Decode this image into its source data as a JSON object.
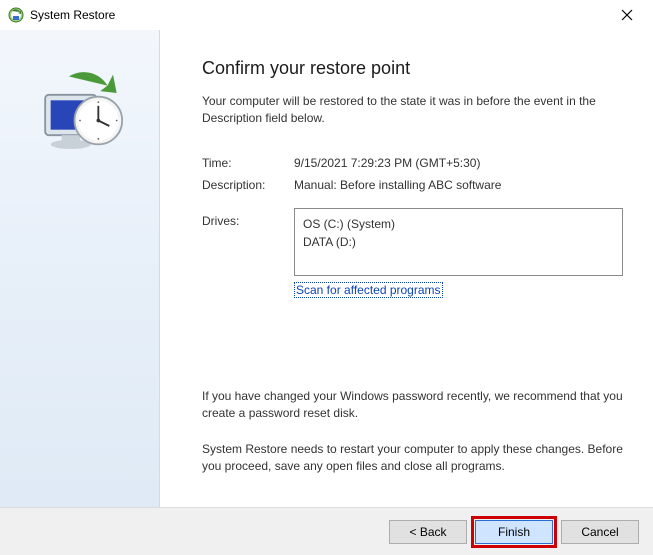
{
  "window": {
    "title": "System Restore"
  },
  "heading": "Confirm your restore point",
  "lead": "Your computer will be restored to the state it was in before the event in the Description field below.",
  "fields": {
    "time_label": "Time:",
    "time_value": "9/15/2021 7:29:23 PM (GMT+5:30)",
    "desc_label": "Description:",
    "desc_value": "Manual: Before installing ABC software",
    "drives_label": "Drives:"
  },
  "drives": {
    "line1": "OS (C:) (System)",
    "line2": "DATA (D:)"
  },
  "scan_link": "Scan for affected programs",
  "note_password": "If you have changed your Windows password recently, we recommend that you create a password reset disk.",
  "note_restart": "System Restore needs to restart your computer to apply these changes. Before you proceed, save any open files and close all programs.",
  "buttons": {
    "back": "< Back",
    "finish": "Finish",
    "cancel": "Cancel"
  }
}
